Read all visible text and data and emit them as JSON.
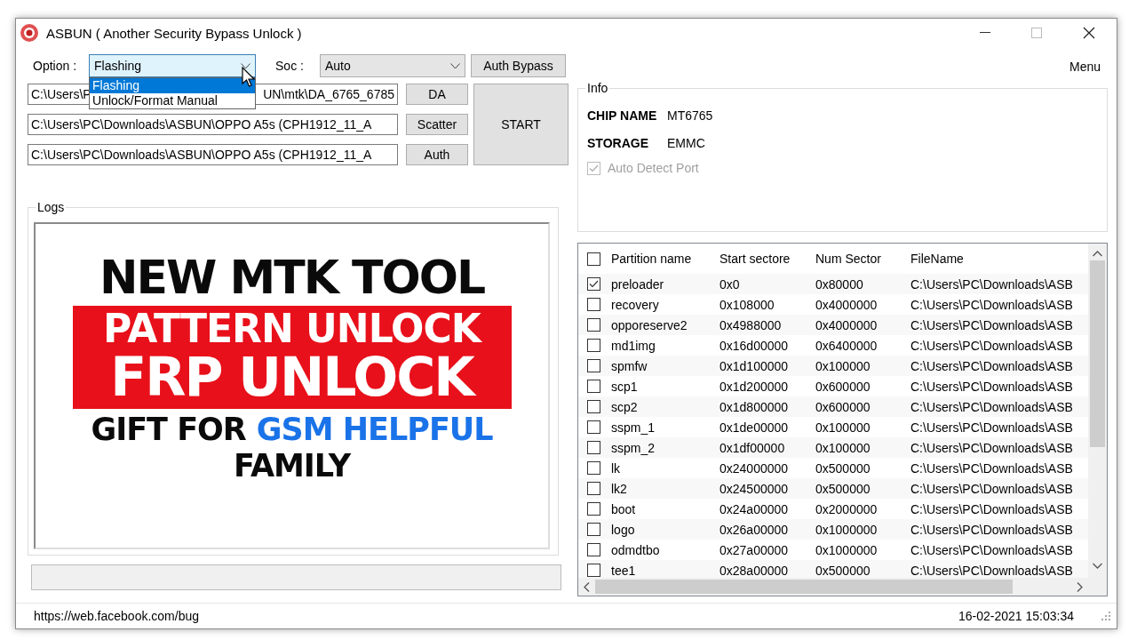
{
  "window": {
    "title": "ASBUN ( Another Security Bypass Unlock )"
  },
  "option": {
    "label": "Option :",
    "value": "Flashing",
    "open": true,
    "items": [
      {
        "label": "Flashing",
        "selected": true
      },
      {
        "label": "Unlock/Format Manual",
        "selected": false
      }
    ]
  },
  "soc": {
    "label": "Soc :",
    "value": "Auto"
  },
  "auth_bypass_button": "Auth Bypass",
  "paths": [
    {
      "value_parts": [
        "C:\\Users\\P",
        "UN\\mtk\\DA_6765_6785"
      ],
      "button": "DA"
    },
    {
      "value_parts": [
        "C:\\Users\\PC\\Downloads\\ASBUN\\OPPO A5s (CPH1912_11_A"
      ],
      "button": "Scatter"
    },
    {
      "value_parts": [
        "C:\\Users\\PC\\Downloads\\ASBUN\\OPPO A5s (CPH1912_11_A"
      ],
      "button": "Auth"
    }
  ],
  "start_button": "START",
  "progress": {
    "level": 0
  },
  "menu": "Menu",
  "info": {
    "title": "Info",
    "fields": [
      {
        "label": "CHIP NAME",
        "value": "MT6765"
      },
      {
        "label": "STORAGE",
        "value": "EMMC"
      }
    ],
    "auto_detect": {
      "label": "Auto Detect Port",
      "checked": true,
      "disabled": true
    }
  },
  "logs": {
    "title": "Logs",
    "overlay_lines": [
      {
        "kind": "plain",
        "segments": [
          {
            "text": "NEW MTK TOOL",
            "kind": "dark"
          }
        ]
      },
      {
        "kind": "banner",
        "segments": [
          {
            "text": "PATTERN UNLOCK",
            "kind": "light"
          }
        ]
      },
      {
        "kind": "banner-large",
        "segments": [
          {
            "text": "FRP UNLOCK",
            "kind": "light"
          }
        ]
      },
      {
        "kind": "small",
        "segments": [
          {
            "text": "GIFT FOR",
            "kind": "dark"
          },
          {
            "text": "GSM HELPFUL",
            "kind": "accent"
          }
        ]
      },
      {
        "kind": "small",
        "segments": [
          {
            "text": "FAMILY",
            "kind": "dark"
          }
        ]
      }
    ]
  },
  "table": {
    "all_checked": false,
    "columns": [
      "Partition name",
      "Start sectore",
      "Num Sector",
      "FileName"
    ],
    "rows": [
      {
        "checked": true,
        "cells": [
          "preloader",
          "0x0",
          "0x80000",
          "C:\\Users\\PC\\Downloads\\ASB"
        ]
      },
      {
        "checked": false,
        "cells": [
          "recovery",
          "0x108000",
          "0x4000000",
          "C:\\Users\\PC\\Downloads\\ASB"
        ]
      },
      {
        "checked": false,
        "cells": [
          "opporeserve2",
          "0x4988000",
          "0x4000000",
          "C:\\Users\\PC\\Downloads\\ASB"
        ]
      },
      {
        "checked": false,
        "cells": [
          "md1img",
          "0x16d00000",
          "0x6400000",
          "C:\\Users\\PC\\Downloads\\ASB"
        ]
      },
      {
        "checked": false,
        "cells": [
          "spmfw",
          "0x1d100000",
          "0x100000",
          "C:\\Users\\PC\\Downloads\\ASB"
        ]
      },
      {
        "checked": false,
        "cells": [
          "scp1",
          "0x1d200000",
          "0x600000",
          "C:\\Users\\PC\\Downloads\\ASB"
        ]
      },
      {
        "checked": false,
        "cells": [
          "scp2",
          "0x1d800000",
          "0x600000",
          "C:\\Users\\PC\\Downloads\\ASB"
        ]
      },
      {
        "checked": false,
        "cells": [
          "sspm_1",
          "0x1de00000",
          "0x100000",
          "C:\\Users\\PC\\Downloads\\ASB"
        ]
      },
      {
        "checked": false,
        "cells": [
          "sspm_2",
          "0x1df00000",
          "0x100000",
          "C:\\Users\\PC\\Downloads\\ASB"
        ]
      },
      {
        "checked": false,
        "cells": [
          "lk",
          "0x24000000",
          "0x500000",
          "C:\\Users\\PC\\Downloads\\ASB"
        ]
      },
      {
        "checked": false,
        "cells": [
          "lk2",
          "0x24500000",
          "0x500000",
          "C:\\Users\\PC\\Downloads\\ASB"
        ]
      },
      {
        "checked": false,
        "cells": [
          "boot",
          "0x24a00000",
          "0x2000000",
          "C:\\Users\\PC\\Downloads\\ASB"
        ]
      },
      {
        "checked": false,
        "cells": [
          "logo",
          "0x26a00000",
          "0x1000000",
          "C:\\Users\\PC\\Downloads\\ASB"
        ]
      },
      {
        "checked": false,
        "cells": [
          "odmdtbo",
          "0x27a00000",
          "0x1000000",
          "C:\\Users\\PC\\Downloads\\ASB"
        ]
      },
      {
        "checked": false,
        "cells": [
          "tee1",
          "0x28a00000",
          "0x500000",
          "C:\\Users\\PC\\Downloads\\ASB"
        ]
      }
    ]
  },
  "status_bar": {
    "link": "https://web.facebook.com/bug",
    "datetime": "16-02-2021 15:03:34"
  }
}
